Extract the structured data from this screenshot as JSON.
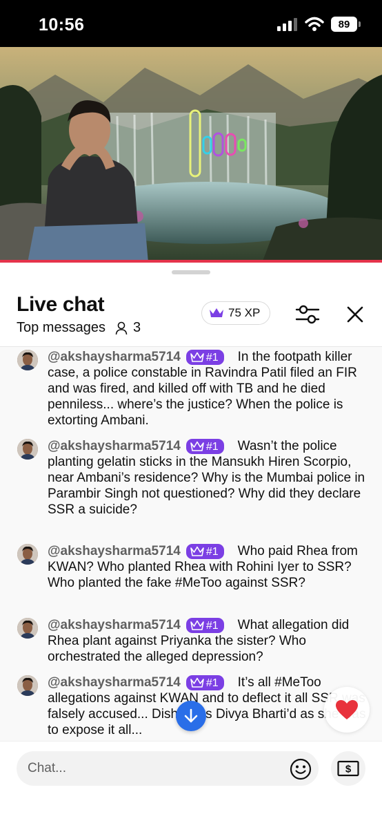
{
  "status_bar": {
    "time": "10:56",
    "battery": "89"
  },
  "header": {
    "title": "Live chat",
    "mode": "Top messages",
    "viewer_count": "3",
    "xp_label": "75 XP"
  },
  "messages": [
    {
      "author": "@akshaysharma5714",
      "badge": "#1",
      "text": "In the footpath killer case, a police constable in Ravindra Patil filed an FIR and was fired, and killed off with TB and he died penniless... where’s the justice? When the police is extorting Ambani."
    },
    {
      "author": "@akshaysharma5714",
      "badge": "#1",
      "text": "Wasn’t the police planting gelatin sticks in the Mansukh Hiren Scorpio, near Ambani’s residence? Why is the Mumbai police in Parambir Singh not questioned? Why did they declare SSR a suicide?"
    },
    {
      "author": "@akshaysharma5714",
      "badge": "#1",
      "text": "Who paid Rhea from KWAN? Who planted Rhea with Rohini Iyer to SSR? Who planted the fake #MeToo against SSR?"
    },
    {
      "author": "@akshaysharma5714",
      "badge": "#1",
      "text": "What allegation did Rhea plant against Priyanka the sister? Who orchestrated the alleged depression?"
    },
    {
      "author": "@akshaysharma5714",
      "badge": "#1",
      "text": "It’s all #MeToo allegations against KWAN and to deflect it all SSR was falsely accused... Disha was Divya Bharti’d as she was to expose it all..."
    }
  ],
  "input": {
    "placeholder": "Chat..."
  },
  "icons": {
    "viewers": "person-icon",
    "xp": "crown-icon",
    "filter": "sliders-icon",
    "close": "close-icon",
    "scroll": "arrow-down-icon",
    "heart": "heart-icon",
    "emoji": "smiley-icon",
    "money": "dollar-bill-icon"
  },
  "colors": {
    "badge": "#7b3fe4",
    "scroll_button": "#2a6ee8",
    "progress": "#e5334b",
    "heart": "#e8323c"
  }
}
